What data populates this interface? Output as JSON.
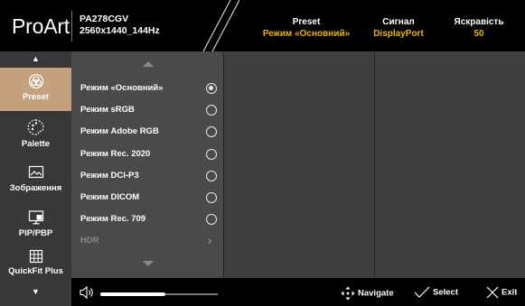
{
  "header": {
    "brand": "ProArt",
    "model_line1": "PA278CGV",
    "model_line2": "2560x1440_144Hz",
    "status": [
      {
        "title": "Preset",
        "value": "Режим «Основний»"
      },
      {
        "title": "Сигнал",
        "value": "DisplayPort"
      },
      {
        "title": "Яскравість",
        "value": "50"
      }
    ],
    "value_color": "#e6b800"
  },
  "rail": {
    "active_color": "#c4a07c",
    "items": [
      {
        "label": "Preset",
        "icon": "preset-icon",
        "active": true
      },
      {
        "label": "Palette",
        "icon": "palette-icon",
        "active": false
      },
      {
        "label": "Зображення",
        "icon": "image-icon",
        "active": false
      },
      {
        "label": "PIP/PBP",
        "icon": "pip-pbp-icon",
        "active": false
      },
      {
        "label": "QuickFit Plus",
        "icon": "quickfit-icon",
        "active": false
      }
    ]
  },
  "options": [
    {
      "label": "Режим «Основний»",
      "selected": true,
      "enabled": true
    },
    {
      "label": "Режим sRGB",
      "selected": false,
      "enabled": true
    },
    {
      "label": "Режим Adobe RGB",
      "selected": false,
      "enabled": true
    },
    {
      "label": "Режим Rec. 2020",
      "selected": false,
      "enabled": true
    },
    {
      "label": "Режим DCI-P3",
      "selected": false,
      "enabled": true
    },
    {
      "label": "Режим DICOM",
      "selected": false,
      "enabled": true
    },
    {
      "label": "Режим Rec. 709",
      "selected": false,
      "enabled": true
    },
    {
      "label": "HDR",
      "selected": false,
      "enabled": false,
      "submenu": true
    }
  ],
  "footer": {
    "volume_level": 0.55,
    "navigate": "Navigate",
    "select": "Select",
    "exit": "Exit"
  }
}
